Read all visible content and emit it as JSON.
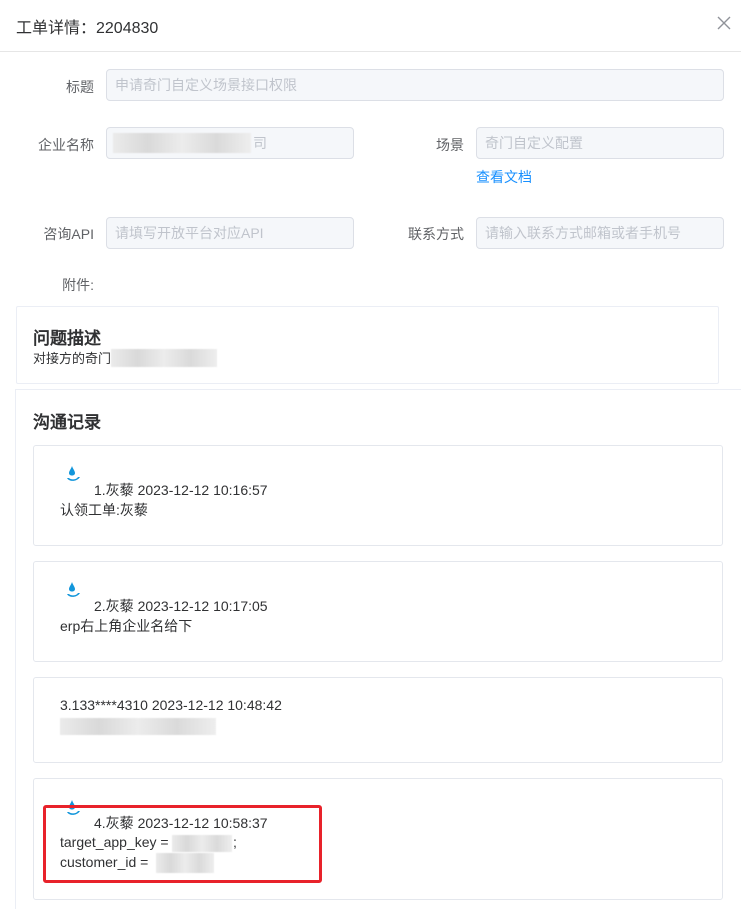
{
  "dialog": {
    "title": "工单详情：2204830"
  },
  "form": {
    "title_label": "标题",
    "title_value": "申请奇门自定义场景接口权限",
    "company_label": "企业名称",
    "company_suffix": "司",
    "scene_label": "场景",
    "scene_value": "奇门自定义配置",
    "doc_link": "查看文档",
    "api_label": "咨询API",
    "api_placeholder": "请填写开放平台对应API",
    "contact_label": "联系方式",
    "contact_placeholder": "请输入联系方式邮箱或者手机号",
    "attachment_label": "附件:"
  },
  "description": {
    "title": "问题描述",
    "text": "对接方的奇门"
  },
  "communication": {
    "title": "沟通记录",
    "records": [
      {
        "meta": "1.灰藜 2023-12-12 10:16:57",
        "body": "认领工单:灰藜",
        "has_icon": true
      },
      {
        "meta": "2.灰藜 2023-12-12 10:17:05",
        "body": "erp右上角企业名给下",
        "has_icon": true
      },
      {
        "meta": "3.133****4310 2023-12-12 10:48:42",
        "body": "",
        "has_icon": false
      },
      {
        "meta": "4.灰藜 2023-12-12 10:58:37",
        "body_line1": "target_app_key =",
        "body_line1_end": ";",
        "body_line2": "customer_id = ",
        "has_icon": true
      }
    ]
  },
  "colors": {
    "accent": "#1890ff",
    "highlight": "#e8222a",
    "icon": "#1296db"
  }
}
